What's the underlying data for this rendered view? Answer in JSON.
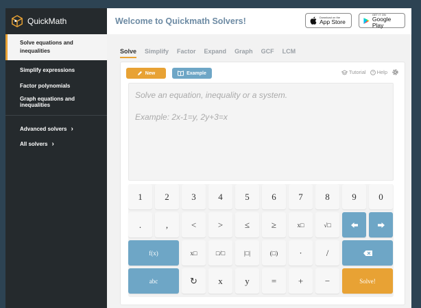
{
  "sidebar": {
    "logo_text": "QuickMath",
    "items": [
      {
        "label": "Solve equations and inequalities",
        "active": true
      },
      {
        "label": "Simplify expressions",
        "active": false
      },
      {
        "label": "Factor polynomials",
        "active": false
      },
      {
        "label": "Graph equations and inequalities",
        "active": false
      }
    ],
    "advanced": "Advanced solvers",
    "all": "All solvers"
  },
  "header": {
    "title": "Welcome to Quickmath Solvers!",
    "app_store_small": "Download on the",
    "app_store_big": "App Store",
    "google_small": "GET IT ON",
    "google_big": "Google Play"
  },
  "tabs": [
    "Solve",
    "Simplify",
    "Factor",
    "Expand",
    "Graph",
    "GCF",
    "LCM"
  ],
  "toolbar": {
    "new_label": "New",
    "example_label": "Example",
    "tutorial_label": "Tutorial",
    "help_label": "Help"
  },
  "input": {
    "placeholder": "Solve an equation, inequality or a system.",
    "example": "Example: 2x-1=y, 2y+3=x"
  },
  "keypad": {
    "row1": [
      "1",
      "2",
      "3",
      "4",
      "5",
      "6",
      "7",
      "8",
      "9",
      "0"
    ],
    "row2": [
      ".",
      ",",
      "<",
      ">",
      "≤",
      "≥",
      "x□",
      "√□"
    ],
    "row3": [
      "f(x)",
      "x□",
      "□/□",
      "|□|",
      "(□)",
      "·",
      "/"
    ],
    "row4": [
      "abc",
      "↻",
      "x",
      "y",
      "=",
      "+",
      "−",
      "Solve!"
    ]
  },
  "colors": {
    "accent": "#e8a234",
    "blue": "#6ea6c6",
    "sidebar": "#252a2d"
  }
}
